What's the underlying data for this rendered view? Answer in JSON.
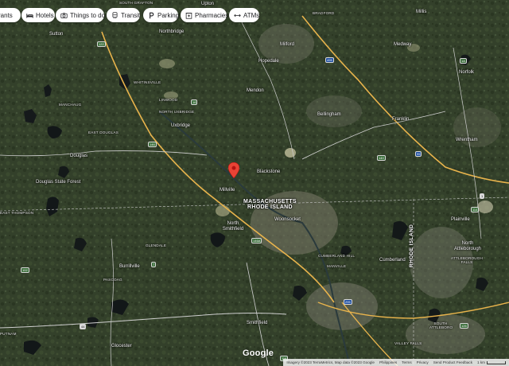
{
  "chips": [
    {
      "label": "rants",
      "icon": "restaurant-icon"
    },
    {
      "label": "Hotels",
      "icon": "bed-icon"
    },
    {
      "label": "Things to do",
      "icon": "camera-icon"
    },
    {
      "label": "Transit",
      "icon": "train-icon"
    },
    {
      "label": "Parking",
      "icon": "parking-icon"
    },
    {
      "label": "Pharmacies",
      "icon": "pharmacy-icon"
    },
    {
      "label": "ATMs",
      "icon": "atm-icon"
    }
  ],
  "places": {
    "south_grafton": "SOUTH GRAFTON",
    "sutton": "Sutton",
    "northbridge": "Northbridge",
    "upton": "Upton",
    "bradford": "BRADFORD",
    "millis": "Millis",
    "milford": "Milford",
    "medway": "Medway",
    "hopedale": "Hopedale",
    "whitinsville": "WHITINSVILLE",
    "norfolk": "Norfolk",
    "manchaug": "MANCHAUG",
    "linwood": "LINWOOD",
    "north_uxbridge": "NORTH UXBRIDGE",
    "mendon": "Mendon",
    "bellingham": "Bellingham",
    "franklin": "Franklin",
    "east_douglas": "EAST DOUGLAS",
    "uxbridge": "Uxbridge",
    "wrentham": "Wrentham",
    "douglas": "Douglas",
    "blackstone": "Blackstone",
    "douglas_state_forest": "Douglas State Forest",
    "millville": "Millville",
    "east_thompson": "EAST THOMPSON",
    "north_smithfield": "North Smithfield",
    "woonsocket": "Woonsocket",
    "plainville": "Plainville",
    "glendale": "GLENDALE",
    "cumberland_hill": "CUMBERLAND HILL",
    "manville": "MANVILLE",
    "cumberland": "Cumberland",
    "north_attleborough": "North Attleborough",
    "attleborough_falls": "ATTLEBOROUGH FALLS",
    "burrillville": "Burrillville",
    "pascoag": "PASCOAG",
    "putnam": "PUTNAM",
    "smithfield": "Smithfield",
    "glocester": "Glocester",
    "south_attleboro": "SOUTH ATTLEBORO",
    "valley_falls": "VALLEY FALLS"
  },
  "state_line": {
    "line1": "MASSACHUSETTS",
    "line2": "RHODE ISLAND"
  },
  "state_vertical": "RHODE ISLAND",
  "routes": [
    "122",
    "146",
    "16",
    "495",
    "1A",
    "140",
    "1",
    "295",
    "95",
    "146A",
    "7",
    "44",
    "116",
    "126",
    "102",
    "114"
  ],
  "marker": "location-pin-icon",
  "logo": "Google",
  "footer": {
    "imagery": "Imagery ©2023 TerraMetrics, Map data ©2023 Google",
    "country": "Philippines",
    "terms": "Terms",
    "privacy": "Privacy",
    "feedback": "Send Product Feedback",
    "scale": "1 km"
  },
  "colors": {
    "pin": "#ea4335",
    "chip_bg": "#ffffff",
    "road": "#e9b44c"
  }
}
